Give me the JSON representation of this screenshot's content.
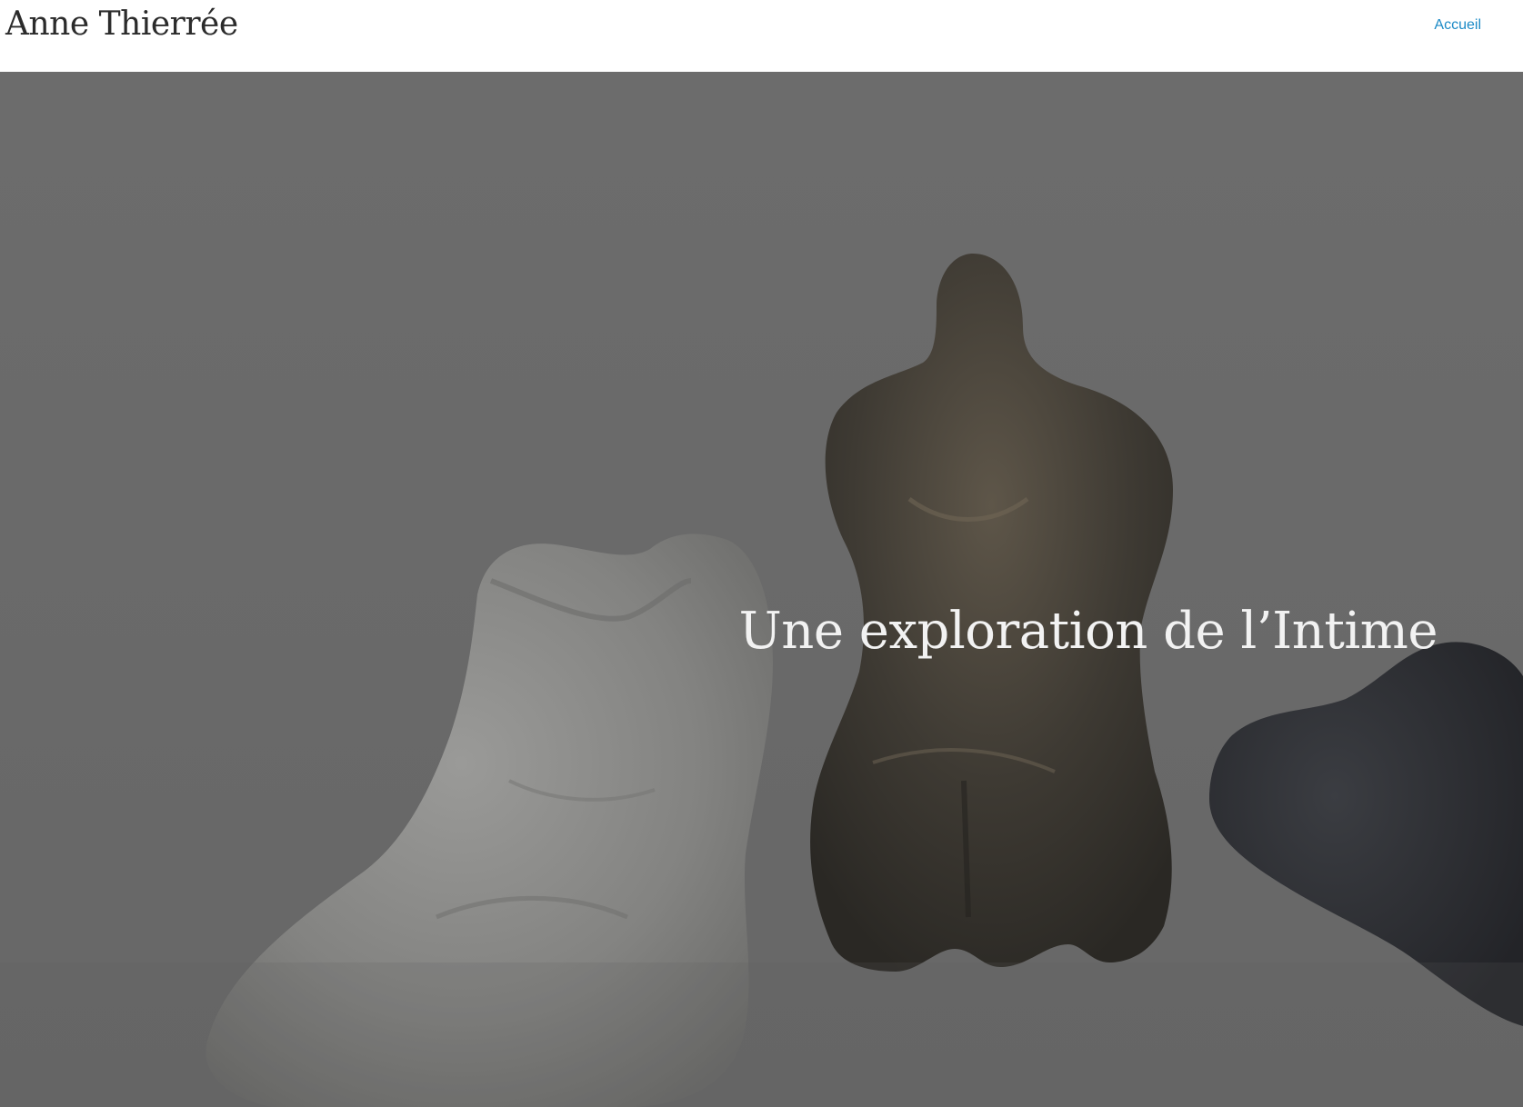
{
  "header": {
    "site_title": "Anne Thierrée",
    "nav": [
      {
        "label": "Accueil"
      }
    ]
  },
  "hero": {
    "title": "Une exploration de l’Intime",
    "overlay_color": "#000000",
    "background_color": "#ececec"
  },
  "colors": {
    "link": "#1b8ac6",
    "title_text": "#2b2b2b",
    "hero_text": "#f2f2f2"
  }
}
